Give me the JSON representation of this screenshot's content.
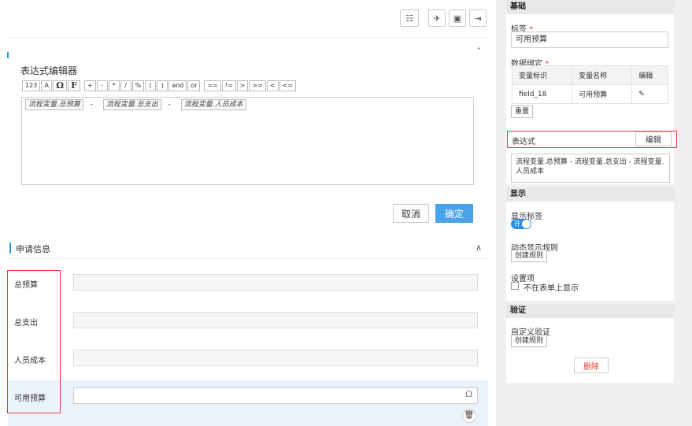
{
  "toolbar": {
    "icons": [
      "layout-icon",
      "rocket-icon",
      "save-icon",
      "exit-icon"
    ]
  },
  "expression_editor": {
    "title": "表达式编辑器",
    "operators_special": [
      "123",
      "A",
      "Ω",
      "F"
    ],
    "operators": [
      "+",
      "-",
      "*",
      "/",
      "%",
      "(",
      ")",
      "and",
      "or",
      "==",
      "!=",
      ">",
      ">=",
      "<",
      "<="
    ],
    "tokens": [
      "流程变量.总预算",
      "流程变量.总支出",
      "流程变量.人员成本"
    ],
    "minus": "-",
    "cancel_label": "取消",
    "ok_label": "确定"
  },
  "form": {
    "section_title": "申请信息",
    "fields": [
      {
        "label": "总预算",
        "value": ""
      },
      {
        "label": "总支出",
        "value": ""
      },
      {
        "label": "人员成本",
        "value": ""
      },
      {
        "label": "可用预算",
        "value": ""
      }
    ]
  },
  "panel": {
    "basic_head": "基础",
    "label_label": "标签",
    "required_mark": "*",
    "label_value": "可用预算",
    "binding_label": "数据绑定",
    "binding_headers": [
      "变量标识",
      "变量名称",
      "编辑"
    ],
    "binding_row": {
      "id": "field_18",
      "name": "可用预算",
      "edit_icon": "pencil-icon"
    },
    "reset_label": "重置",
    "expr_label": "表达式",
    "expr_edit": "编辑",
    "expr_text": "流程变量.总预算 - 流程变量.总支出 - 流程变量.人员成本",
    "display_head": "显示",
    "show_label": "显示标签",
    "toggle_text": "开",
    "dynamic_rule_label": "动态显示规则",
    "create_rule": "创建规则",
    "settings_label": "设置项",
    "hide_on_form": "不在表单上显示",
    "validation_head": "验证",
    "custom_validation": "自定义验证",
    "create_rule2": "创建规则",
    "delete_label": "删除"
  }
}
